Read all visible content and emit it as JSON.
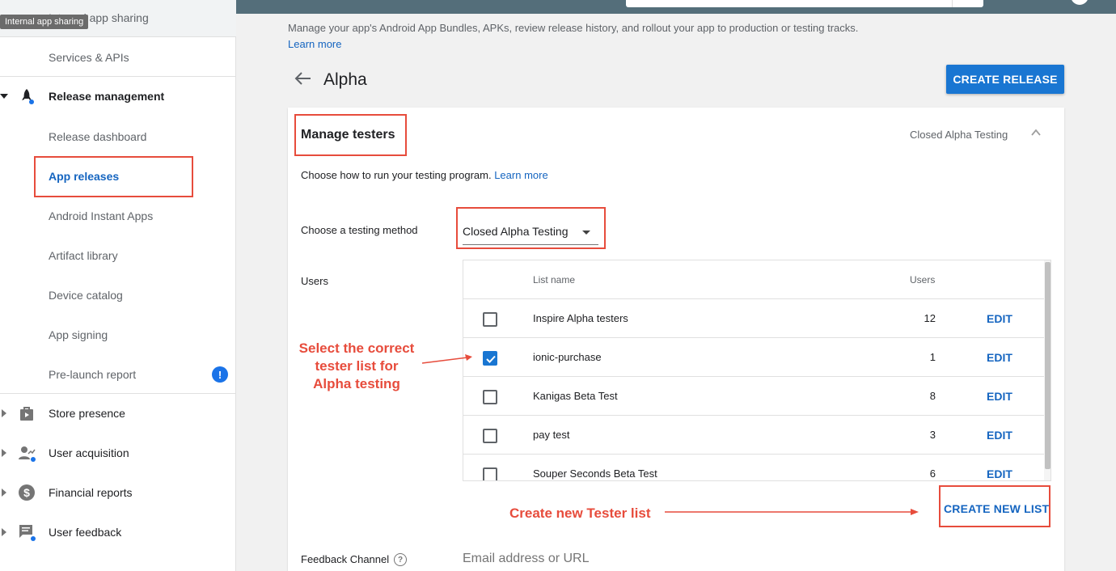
{
  "tooltip": "Internal app sharing",
  "sidebar": {
    "items": [
      {
        "label": "Internal app sharing"
      },
      {
        "label": "Services & APIs"
      },
      {
        "label": "Release management"
      },
      {
        "label": "Release dashboard"
      },
      {
        "label": "App releases"
      },
      {
        "label": "Android Instant Apps"
      },
      {
        "label": "Artifact library"
      },
      {
        "label": "Device catalog"
      },
      {
        "label": "App signing"
      },
      {
        "label": "Pre-launch report",
        "badge": "!"
      },
      {
        "label": "Store presence"
      },
      {
        "label": "User acquisition"
      },
      {
        "label": "Financial reports"
      },
      {
        "label": "User feedback"
      }
    ]
  },
  "header": {
    "description": "Manage your app's Android App Bundles, APKs, review release history, and rollout your app to production or testing tracks.",
    "learn_more": "Learn more",
    "title": "Alpha",
    "create_release": "CREATE RELEASE"
  },
  "card": {
    "title": "Manage testers",
    "status": "Closed Alpha Testing",
    "choose_text": "Choose how to run your testing program.",
    "learn_more": "Learn more",
    "method_label": "Choose a testing method",
    "method_value": "Closed Alpha Testing",
    "users_label": "Users",
    "table": {
      "headers": {
        "name": "List name",
        "users": "Users"
      },
      "rows": [
        {
          "name": "Inspire Alpha testers",
          "users": "12",
          "checked": false,
          "edit": "EDIT"
        },
        {
          "name": "ionic-purchase",
          "users": "1",
          "checked": true,
          "edit": "EDIT"
        },
        {
          "name": "Kanigas Beta Test",
          "users": "8",
          "checked": false,
          "edit": "EDIT"
        },
        {
          "name": "pay test",
          "users": "3",
          "checked": false,
          "edit": "EDIT"
        },
        {
          "name": "Souper Seconds Beta Test",
          "users": "6",
          "checked": false,
          "edit": "EDIT"
        }
      ]
    },
    "create_new_list": "CREATE NEW LIST",
    "feedback_label": "Feedback Channel",
    "feedback_help": "?",
    "feedback_placeholder": "Email address or URL"
  },
  "annotations": {
    "select_line1": "Select the correct",
    "select_line2": "tester list for",
    "select_line3": "Alpha testing",
    "create_note": "Create new Tester list"
  },
  "colors": {
    "accent": "#1976d2",
    "annotation": "#e74c3c",
    "topbar": "#546e7a"
  }
}
